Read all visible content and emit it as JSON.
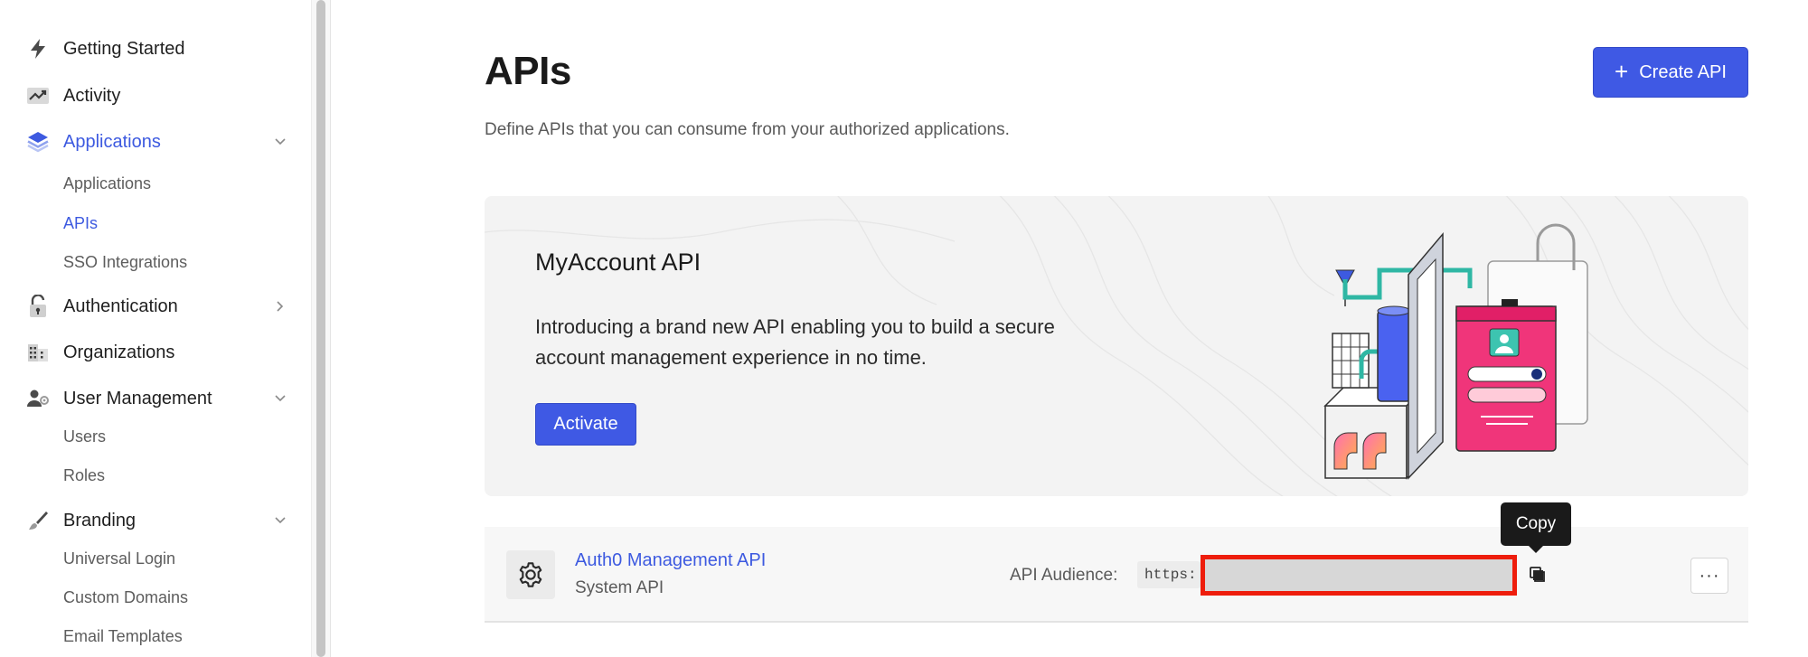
{
  "sidebar": {
    "items": [
      {
        "label": "Getting Started",
        "icon": "bolt-icon"
      },
      {
        "label": "Activity",
        "icon": "activity-chart-icon"
      },
      {
        "label": "Applications",
        "icon": "layers-icon",
        "active": true,
        "expanded": true,
        "children": [
          {
            "label": "Applications"
          },
          {
            "label": "APIs",
            "active": true
          },
          {
            "label": "SSO Integrations"
          }
        ]
      },
      {
        "label": "Authentication",
        "icon": "lock-icon",
        "expanded": false
      },
      {
        "label": "Organizations",
        "icon": "building-icon"
      },
      {
        "label": "User Management",
        "icon": "users-gear-icon",
        "expanded": true,
        "children": [
          {
            "label": "Users"
          },
          {
            "label": "Roles"
          }
        ]
      },
      {
        "label": "Branding",
        "icon": "brush-icon",
        "expanded": true,
        "children": [
          {
            "label": "Universal Login"
          },
          {
            "label": "Custom Domains"
          },
          {
            "label": "Email Templates"
          }
        ]
      }
    ]
  },
  "header": {
    "title": "APIs",
    "description": "Define APIs that you can consume from your authorized applications.",
    "create_button": {
      "icon": "+",
      "label": "Create API"
    }
  },
  "promo": {
    "title": "MyAccount API",
    "text": "Introducing a brand new API enabling you to build a secure account management experience in no time.",
    "button": "Activate"
  },
  "api_list": [
    {
      "name": "Auth0 Management API",
      "type": "System API",
      "audience_label": "API Audience:",
      "audience_prefix": "https:",
      "more_icon": "···"
    }
  ],
  "tooltip": {
    "text": "Copy"
  },
  "colors": {
    "accent": "#3f59e4",
    "link": "#3d5ae0",
    "redaction_border": "#ee1d0c"
  }
}
